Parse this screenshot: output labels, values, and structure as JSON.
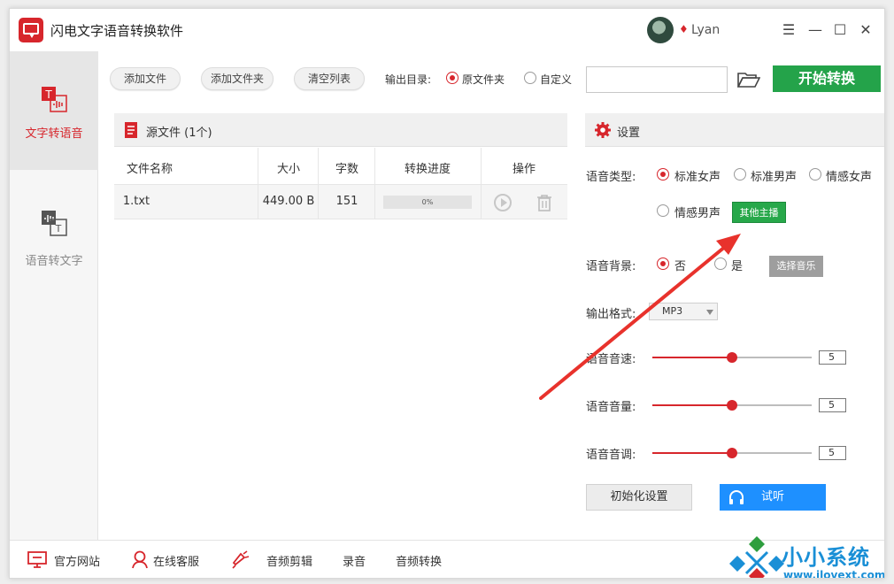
{
  "app": {
    "title": "闪电文字语音转换软件",
    "username": "Lyan"
  },
  "sidebar": {
    "items": [
      {
        "label": "文字转语音",
        "active": true
      },
      {
        "label": "语音转文字",
        "active": false
      }
    ]
  },
  "toolbar": {
    "add_file": "添加文件",
    "add_folder": "添加文件夹",
    "clear_list": "清空列表",
    "output_label": "输出目录:",
    "opt_source": "原文件夹",
    "opt_custom": "自定义",
    "path_value": "",
    "start": "开始转换"
  },
  "files": {
    "header": "源文件 (1个)",
    "columns": [
      "文件名称",
      "大小",
      "字数",
      "转换进度",
      "操作"
    ],
    "rows": [
      {
        "name": "1.txt",
        "size": "449.00 B",
        "chars": "151",
        "progress": "0%"
      }
    ]
  },
  "settings": {
    "header": "设置",
    "voice_type_label": "语音类型:",
    "voices": [
      "标准女声",
      "标准男声",
      "情感女声",
      "情感男声"
    ],
    "selected_voice": "标准女声",
    "other_anchor": "其他主播",
    "bg_label": "语音背景:",
    "bg_no": "否",
    "bg_yes": "是",
    "choose_music": "选择音乐",
    "format_label": "输出格式:",
    "format_value": "MP3",
    "speed_label": "语音音速:",
    "speed_value": "5",
    "volume_label": "语音音量:",
    "volume_value": "5",
    "pitch_label": "语音音调:",
    "pitch_value": "5",
    "reset": "初始化设置",
    "listen": "试听"
  },
  "footer": {
    "website": "官方网站",
    "support": "在线客服",
    "audio_edit": "音频剪辑",
    "record": "录音",
    "audio_convert": "音频转换"
  },
  "watermark": {
    "brand": "小小系统迷",
    "url": "www.ilovext.com"
  },
  "colors": {
    "accent": "#d7262c",
    "green": "#24a34a",
    "blue": "#1e90ff"
  }
}
